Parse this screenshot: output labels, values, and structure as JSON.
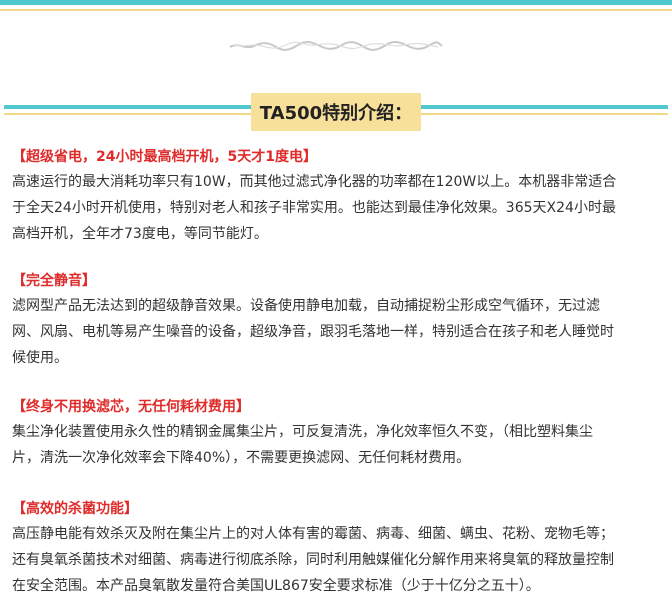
{
  "colors": {
    "teal": "#4fc9cf",
    "yellow": "#f2d98a",
    "title_bg": "#f7e09a",
    "heading_red": "#e02b2b"
  },
  "header": {
    "title": "TA500特别介绍："
  },
  "sections": [
    {
      "title": "【超级省电，24小时最高档开机，5天才1度电】",
      "lines": [
        "高速运行的最大消耗功率只有10W，而其他过滤式净化器的功率都在120W以上。本机器非常适合",
        "于全天24小时开机使用，特别对老人和孩子非常实用。也能达到最佳净化效果。365天X24小时最",
        "高档开机，全年才73度电，等同节能灯。"
      ]
    },
    {
      "title": "【完全静音】",
      "lines": [
        "滤网型产品无法达到的超级静音效果。设备使用静电加载，自动捕捉粉尘形成空气循环，无过滤",
        "网、风扇、电机等易产生噪音的设备，超级净音，跟羽毛落地一样，特别适合在孩子和老人睡觉时",
        "候使用。"
      ]
    },
    {
      "title": "【终身不用换滤芯，无任何耗材费用】",
      "lines": [
        "集尘净化装置使用永久性的精钢金属集尘片，可反复清洗，净化效率恒久不变，（相比塑料集尘",
        "片，清洗一次净化效率会下降40%），不需要更换滤网、无任何耗材费用。"
      ]
    },
    {
      "title": "【高效的杀菌功能】",
      "lines": [
        "高压静电能有效杀灭及附在集尘片上的对人体有害的霉菌、病毒、细菌、螨虫、花粉、宠物毛等；",
        "还有臭氧杀菌技术对细菌、病毒进行彻底杀除，同时利用触媒催化分解作用来将臭氧的释放量控制",
        "在安全范围。本产品臭氧散发量符合美国UL867安全要求标准（少于十亿分之五十）。"
      ]
    }
  ]
}
